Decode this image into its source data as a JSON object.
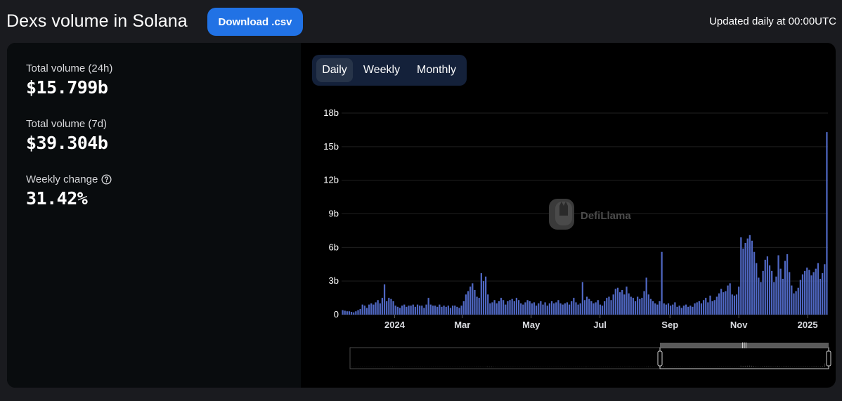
{
  "header": {
    "title": "Dexs volume in Solana",
    "download_label": "Download .csv",
    "updated_text": "Updated daily at 00:00UTC"
  },
  "stats": [
    {
      "label": "Total volume (24h)",
      "value": "$15.799b"
    },
    {
      "label": "Total volume (7d)",
      "value": "$39.304b"
    },
    {
      "label": "Weekly change",
      "value": "31.42%",
      "help_icon": "question-circle-icon"
    }
  ],
  "tabs": [
    {
      "label": "Daily",
      "active": true
    },
    {
      "label": "Weekly",
      "active": false
    },
    {
      "label": "Monthly",
      "active": false
    }
  ],
  "watermark": {
    "text": "DefiLlama",
    "icon": "llama-logo-icon"
  },
  "colors": {
    "accent": "#2172e5",
    "bar": "#4f67c2",
    "tabs_bg": "#14213a",
    "tab_active_bg": "#273449"
  },
  "chart_data": {
    "type": "bar",
    "x_start": "2023-11-15",
    "x_end": "2025-01-19",
    "y_tick_labels": [
      "0",
      "3b",
      "6b",
      "9b",
      "12b",
      "15b",
      "18b"
    ],
    "y_ticks": [
      0,
      3,
      6,
      9,
      12,
      15,
      18
    ],
    "ylim": [
      0,
      18
    ],
    "x_ticks": [
      {
        "label": "2024",
        "date": "2024-01-01"
      },
      {
        "label": "Mar",
        "date": "2024-03-01"
      },
      {
        "label": "May",
        "date": "2024-05-01"
      },
      {
        "label": "Jul",
        "date": "2024-07-01"
      },
      {
        "label": "Sep",
        "date": "2024-09-01"
      },
      {
        "label": "Nov",
        "date": "2024-11-01"
      },
      {
        "label": "2025",
        "date": "2025-01-01"
      }
    ],
    "series": [
      {
        "values_billion": [
          0.4,
          0.35,
          0.3,
          0.3,
          0.25,
          0.2,
          0.3,
          0.4,
          0.5,
          0.9,
          0.8,
          0.6,
          0.9,
          1.0,
          0.9,
          1.1,
          1.3,
          1.0,
          1.5,
          2.7,
          1.2,
          1.5,
          1.4,
          1.2,
          0.8,
          0.7,
          0.6,
          0.8,
          0.9,
          0.7,
          0.8,
          0.8,
          0.9,
          0.7,
          0.9,
          0.8,
          0.8,
          0.6,
          0.9,
          1.5,
          0.9,
          0.8,
          0.8,
          0.7,
          0.9,
          0.7,
          0.8,
          0.7,
          0.8,
          0.6,
          0.8,
          0.8,
          0.7,
          0.6,
          0.8,
          1.2,
          1.8,
          2.1,
          2.5,
          2.8,
          2.2,
          1.6,
          1.5,
          3.7,
          3.0,
          3.4,
          1.8,
          1.0,
          1.1,
          1.3,
          1.0,
          1.2,
          1.5,
          1.3,
          0.9,
          1.2,
          1.3,
          1.4,
          1.2,
          1.5,
          1.3,
          1.0,
          0.9,
          1.1,
          1.3,
          1.2,
          1.0,
          1.1,
          0.8,
          1.0,
          1.2,
          0.9,
          1.1,
          0.8,
          1.0,
          1.2,
          1.0,
          1.1,
          1.3,
          1.0,
          0.9,
          1.0,
          1.1,
          0.9,
          1.2,
          1.5,
          1.1,
          0.9,
          1.0,
          2.9,
          1.3,
          1.6,
          1.4,
          1.2,
          1.0,
          1.1,
          1.3,
          0.9,
          0.8,
          1.2,
          1.5,
          1.6,
          1.3,
          1.8,
          2.3,
          2.4,
          2.0,
          2.2,
          1.8,
          2.5,
          1.9,
          1.6,
          1.5,
          1.2,
          1.6,
          1.4,
          1.5,
          2.1,
          3.3,
          1.8,
          1.4,
          1.2,
          1.0,
          0.9,
          1.2,
          5.6,
          1.0,
          0.9,
          1.0,
          0.8,
          0.9,
          1.1,
          0.7,
          0.8,
          0.6,
          0.8,
          0.9,
          0.7,
          0.8,
          0.7,
          1.0,
          1.1,
          1.2,
          1.0,
          1.3,
          1.5,
          1.1,
          1.7,
          1.2,
          1.3,
          1.6,
          1.9,
          2.3,
          2.0,
          2.1,
          2.6,
          2.8,
          1.8,
          1.7,
          1.8,
          2.5,
          6.9,
          5.9,
          6.4,
          6.8,
          7.1,
          6.6,
          5.6,
          4.6,
          3.3,
          2.9,
          3.9,
          4.9,
          5.2,
          4.4,
          3.9,
          2.9,
          3.4,
          5.3,
          4.1,
          3.2,
          4.8,
          5.4,
          3.8,
          2.6,
          1.9,
          2.1,
          2.4,
          3.1,
          3.6,
          3.9,
          4.2,
          4.0,
          3.5,
          3.8,
          4.1,
          4.6,
          3.2,
          3.7,
          4.5,
          16.3
        ]
      }
    ]
  }
}
